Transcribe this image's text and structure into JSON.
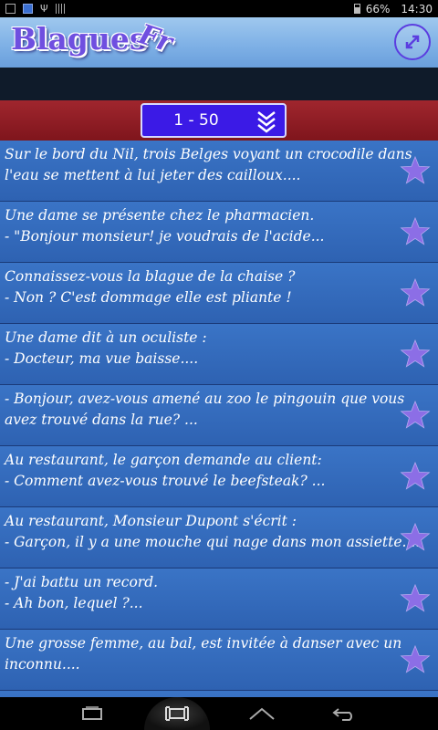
{
  "status_bar": {
    "battery": "66%",
    "time": "14:30"
  },
  "header": {
    "logo_text": "Blagues",
    "logo_suffix": "Fr"
  },
  "pager": {
    "range": "1 - 50"
  },
  "jokes": [
    {
      "line1": "Sur le bord du Nil, trois Belges voyant un crocodile dans",
      "line2": "l'eau se mettent à lui jeter des cailloux...."
    },
    {
      "line1": "Une dame se présente chez le pharmacien.",
      "line2": "- \"Bonjour monsieur! je voudrais de l'acide..."
    },
    {
      "line1": "Connaissez-vous la blague de la chaise ?",
      "line2": "- Non ? C'est dommage elle est pliante !"
    },
    {
      "line1": "Une dame dit à un oculiste :",
      "line2": "- Docteur, ma vue baisse...."
    },
    {
      "line1": "- Bonjour, avez-vous amené au zoo le pingouin que vous",
      "line2": "avez trouvé dans la rue? ..."
    },
    {
      "line1": "Au restaurant, le garçon demande au client:",
      "line2": "- Comment avez-vous trouvé le beefsteak? ..."
    },
    {
      "line1": "Au restaurant, Monsieur Dupont s'écrit :",
      "line2": "- Garçon, il y a une mouche qui nage dans mon assiette...."
    },
    {
      "line1": "- J'ai battu un record.",
      "line2": "- Ah bon, lequel ?..."
    },
    {
      "line1": "Une grosse femme, au bal, est invitée à danser avec un",
      "line2": "inconnu...."
    },
    {
      "line1": "",
      "line2": ""
    }
  ],
  "colors": {
    "star": "#8c6ee6",
    "list_bg": "#3568bb",
    "band": "#8e1d24",
    "selector": "#3b1ae6"
  }
}
